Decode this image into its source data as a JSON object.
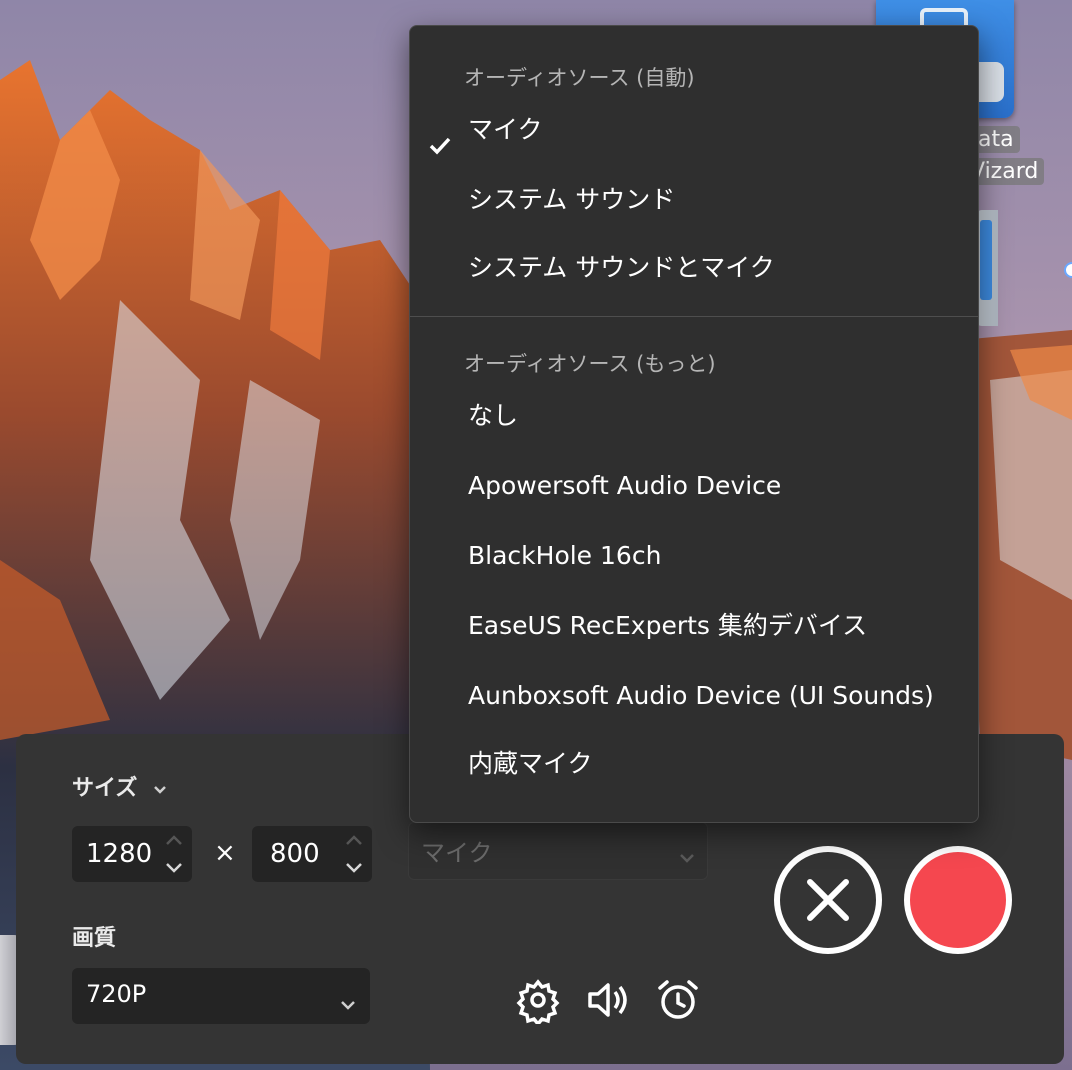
{
  "desktop": {
    "icon_label_line1": "ata",
    "icon_label_line2": "Vizard"
  },
  "recorder": {
    "size_label": "サイズ",
    "width_value": "1280",
    "times_symbol": "×",
    "height_value": "800",
    "audio_select_value": "マイク",
    "quality_label": "画質",
    "quality_value": "720P"
  },
  "audio_menu": {
    "section_auto_header": "オーディオソース (自動)",
    "auto_items": [
      {
        "label": "マイク",
        "checked": true
      },
      {
        "label": "システム サウンド",
        "checked": false
      },
      {
        "label": "システム サウンドとマイク",
        "checked": false
      }
    ],
    "section_more_header": "オーディオソース (もっと)",
    "more_items": [
      {
        "label": "なし"
      },
      {
        "label": "Apowersoft Audio Device"
      },
      {
        "label": "BlackHole 16ch"
      },
      {
        "label": "EaseUS RecExperts 集約デバイス"
      },
      {
        "label": "Aunboxsoft Audio Device (UI Sounds)"
      },
      {
        "label": "内蔵マイク"
      }
    ]
  },
  "colors": {
    "record_button": "#f5474f",
    "panel_bg": "#343434",
    "menu_bg": "#2f2f2f"
  },
  "icons": [
    "check-icon",
    "chevron-down-icon",
    "settings-gear-icon",
    "speaker-icon",
    "alarm-clock-icon",
    "close-x-icon"
  ]
}
